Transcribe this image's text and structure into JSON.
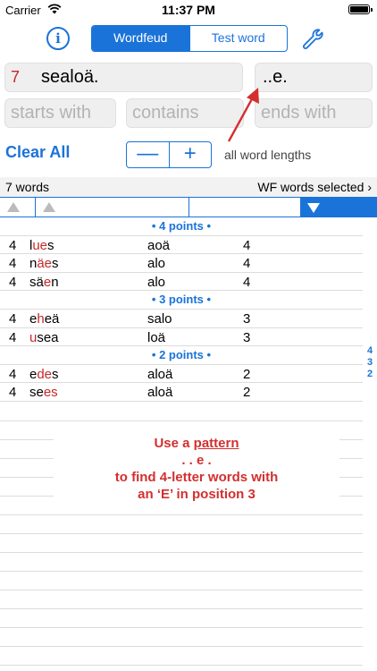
{
  "status_bar": {
    "carrier": "Carrier",
    "time": "11:37 PM"
  },
  "toolbar": {
    "info_label": "i",
    "tabs": [
      "Wordfeud",
      "Test word"
    ],
    "active_tab": 0
  },
  "letters_input": {
    "count": "7",
    "value": "sealoä."
  },
  "pattern_input": {
    "value": "..e."
  },
  "filters": {
    "starts_with": "starts with",
    "contains": "contains",
    "ends_with": "ends with"
  },
  "controls": {
    "clear_all": "Clear All",
    "minus": "—",
    "plus": "+",
    "lengths": "all word lengths"
  },
  "summary": {
    "count": "7 words",
    "selected": "WF words selected ›"
  },
  "sections": [
    {
      "header": "• 4 points •",
      "rows": [
        {
          "len": "4",
          "pre": "l",
          "hl": "ue",
          "post": "s",
          "used": "aoä",
          "pts": "4"
        },
        {
          "len": "4",
          "pre": "n",
          "hl": "äe",
          "post": "s",
          "used": "alo",
          "pts": "4"
        },
        {
          "len": "4",
          "pre": "sä",
          "hl": "e",
          "post": "n",
          "used": "alo",
          "pts": "4"
        }
      ]
    },
    {
      "header": "• 3 points •",
      "rows": [
        {
          "len": "4",
          "pre": "e",
          "hl": "h",
          "post": "eä",
          "used": "salo",
          "pts": "3"
        },
        {
          "len": "4",
          "pre": "",
          "hl": "u",
          "post": "sea",
          "used": "loä",
          "pts": "3"
        }
      ]
    },
    {
      "header": "• 2 points •",
      "rows": [
        {
          "len": "4",
          "pre": "e",
          "hl": "de",
          "post": "s",
          "used": "aloä",
          "pts": "2"
        },
        {
          "len": "4",
          "pre": "se",
          "hl": "es",
          "post": "",
          "used": "aloä",
          "pts": "2"
        }
      ]
    }
  ],
  "index": [
    "4",
    "3",
    "2"
  ],
  "note": {
    "line1a": "Use a ",
    "line1b": "pattern",
    "line2": ". . e .",
    "line3": "to find 4-letter words with",
    "line4": "an ‘E’ in position 3"
  },
  "colors": {
    "accent": "#1a73d9",
    "highlight": "#c62828",
    "note": "#d32f2f"
  }
}
